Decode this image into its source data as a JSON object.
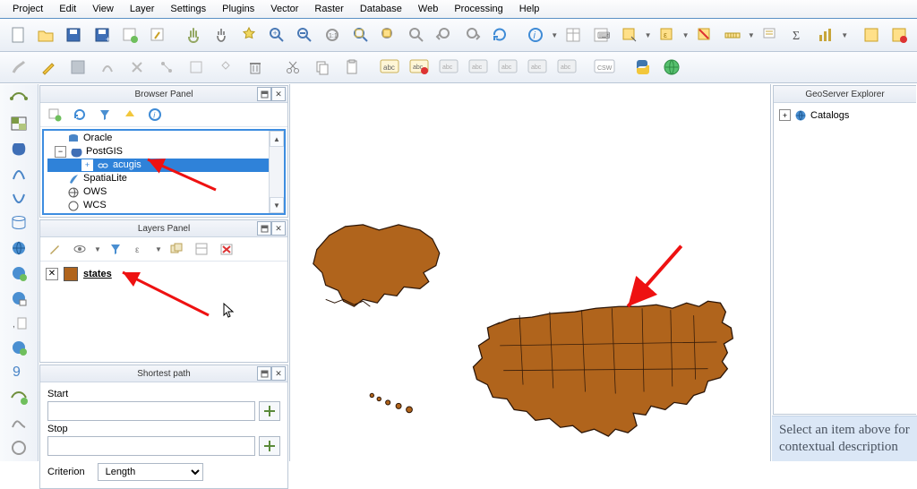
{
  "menubar": [
    "Project",
    "Edit",
    "View",
    "Layer",
    "Settings",
    "Plugins",
    "Vector",
    "Raster",
    "Database",
    "Web",
    "Processing",
    "Help"
  ],
  "panels": {
    "browser": {
      "title": "Browser Panel",
      "items": [
        {
          "label": "Oracle",
          "indent": 22,
          "icon": "db-icon"
        },
        {
          "label": "PostGIS",
          "indent": 22,
          "icon": "elephant-icon",
          "expand": "minus"
        },
        {
          "label": "acugis",
          "indent": 52,
          "icon": "link-icon",
          "selected": true,
          "expand": "plus"
        },
        {
          "label": "SpatiaLite",
          "indent": 22,
          "icon": "feather-icon"
        },
        {
          "label": "OWS",
          "indent": 22,
          "icon": "globe-icon"
        },
        {
          "label": "WCS",
          "indent": 22,
          "icon": "globe-icon"
        }
      ]
    },
    "layers": {
      "title": "Layers Panel",
      "items": [
        {
          "checked": true,
          "color": "#b0641c",
          "name": "states"
        }
      ]
    },
    "shortest_path": {
      "title": "Shortest path",
      "start_label": "Start",
      "stop_label": "Stop",
      "criterion_label": "Criterion",
      "criterion_value": "Length"
    },
    "geoserver": {
      "title": "GeoServer Explorer",
      "root": "Catalogs"
    }
  },
  "hint_text": "Select an item above for contextual description",
  "chart_data": {
    "type": "map",
    "layer": "states",
    "fill": "#b0641c",
    "stroke": "#2b1507",
    "regions": [
      "USA contiguous",
      "Alaska",
      "Hawaii"
    ]
  }
}
